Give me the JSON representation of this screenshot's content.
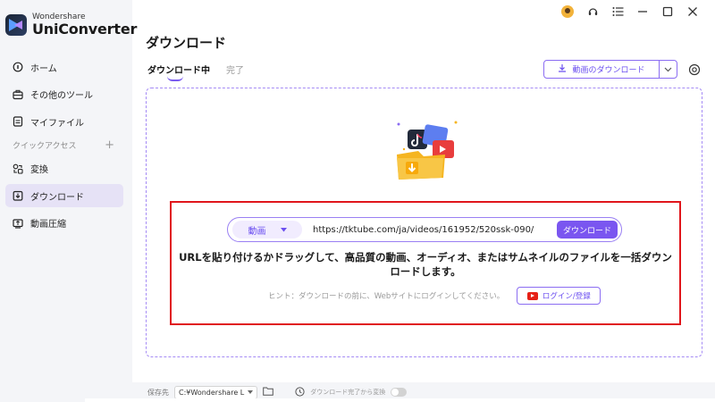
{
  "app": {
    "brand_small": "Wondershare",
    "brand_name": "UniConverter"
  },
  "sidebar": {
    "items": [
      {
        "label": "ホーム",
        "icon": "home-icon"
      },
      {
        "label": "その他のツール",
        "icon": "toolbox-icon"
      },
      {
        "label": "マイファイル",
        "icon": "file-icon"
      }
    ],
    "section_label": "クイックアクセス",
    "section_add": "+",
    "quick_items": [
      {
        "label": "変換",
        "icon": "convert-icon"
      },
      {
        "label": "ダウンロード",
        "icon": "download-icon",
        "active": true
      },
      {
        "label": "動画圧縮",
        "icon": "compress-icon"
      }
    ]
  },
  "header": {
    "title": "ダウンロード",
    "tabs": [
      {
        "label": "ダウンロード中",
        "active": true
      },
      {
        "label": "完了",
        "active": false
      }
    ],
    "download_button_label": "動画のダウンロード"
  },
  "main": {
    "type_select_value": "動画",
    "url_value": "https://tktube.com/ja/videos/161952/520ssk-090/",
    "download_label": "ダウンロード",
    "instruction": "URLを貼り付けるかドラッグして、高品質の動画、オーディオ、またはサムネイルのファイルを一括ダウンロードします。",
    "hint": "ヒント：ダウンロードの前に、Webサイトにログインしてください。",
    "login_label": "ログイン/登録"
  },
  "bottom": {
    "save_label": "保存先",
    "path_value": "C:¥Wondershare L",
    "auto_label": "ダウンロード完了から変換"
  },
  "colors": {
    "accent": "#7a56f0",
    "highlight": "#e0161c",
    "sidebar_bg": "#f4f5f8",
    "active_item_bg": "#e6e2f6"
  }
}
